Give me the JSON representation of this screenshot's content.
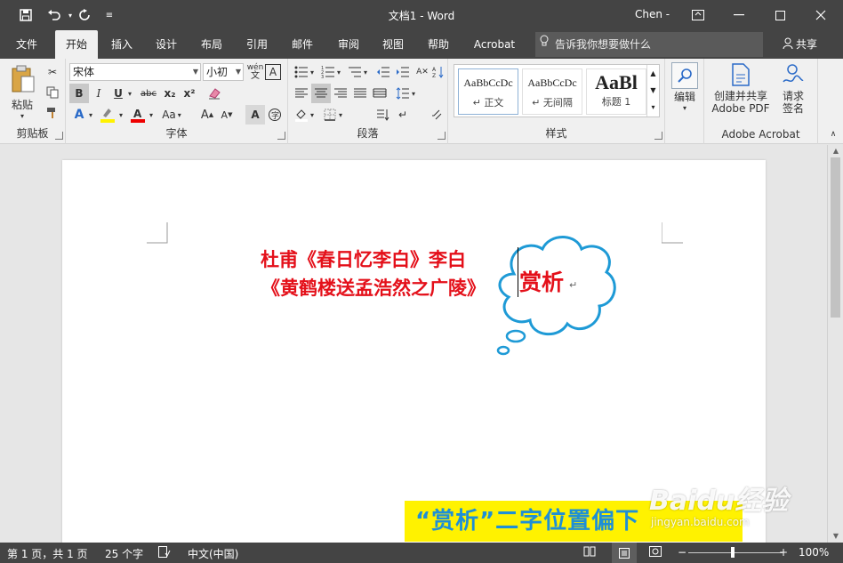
{
  "titlebar": {
    "title": "文档1  -  Word",
    "user": "Chen -",
    "qa_save_icon": "save-icon",
    "qa_undo_icon": "undo-icon",
    "qa_redo_icon": "redo-icon"
  },
  "tabs": [
    "文件",
    "开始",
    "插入",
    "设计",
    "布局",
    "引用",
    "邮件",
    "审阅",
    "视图",
    "帮助",
    "Acrobat"
  ],
  "active_tab": "开始",
  "tellme": "告诉我你想要做什么",
  "share": "共享",
  "ribbon": {
    "clipboard": {
      "paste": "粘贴",
      "label": "剪贴板"
    },
    "font": {
      "name": "宋体",
      "size": "小初",
      "label": "字体",
      "wen": "wén",
      "A": "A",
      "bold": "B",
      "italic": "I",
      "underline": "U",
      "strike": "abc",
      "sub": "x₂",
      "sup": "x²",
      "aa": "Aa"
    },
    "paragraph": {
      "label": "段落"
    },
    "styles": {
      "label": "样式",
      "items": [
        {
          "preview": "AaBbCcDc",
          "name": "↵ 正文"
        },
        {
          "preview": "AaBbCcDc",
          "name": "↵ 无间隔"
        },
        {
          "preview": "AaBl",
          "name": "标题 1"
        }
      ]
    },
    "editing": {
      "label": "编辑"
    },
    "acrobat": {
      "create": "创建并共享",
      "create2": "Adobe PDF",
      "sign": "请求",
      "sign2": "签名",
      "label": "Adobe Acrobat"
    }
  },
  "document": {
    "line1": "杜甫《春日忆李白》李白",
    "line2": "《黄鹤楼送孟浩然之广陵》",
    "cloud_text": "赏析",
    "para_mark": "↵",
    "callout": "“赏析”二字位置偏下",
    "colors": {
      "red_text": "#e4101a",
      "cloud_stroke": "#1e9ad6",
      "callout_bg": "#fff200",
      "callout_text": "#1e8fd6"
    }
  },
  "watermark": {
    "logo": "Baidu经验",
    "url": "jingyan.baidu.com"
  },
  "statusbar": {
    "page": "第 1 页，共 1 页",
    "words": "25 个字",
    "lang": "中文(中国)",
    "zoom": "100%"
  }
}
